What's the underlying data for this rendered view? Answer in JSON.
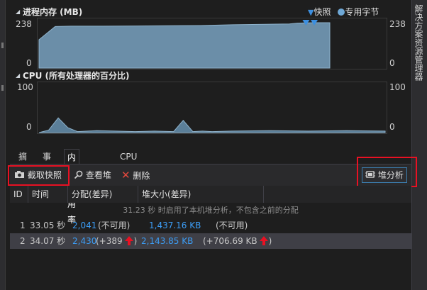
{
  "right_panel": {
    "label": "解决方案资源管理器"
  },
  "memory_panel": {
    "title": "进程内存 (MB)",
    "legend_snapshot": "快照",
    "legend_private": "专用字节",
    "y_max": "238",
    "y_min": "0",
    "y_max_right": "238",
    "y_min_right": "0",
    "colors": {
      "fill": "#6b8ea8",
      "stroke": "#8fb3cc",
      "snapshot_marker": "#3c8fe0"
    }
  },
  "cpu_panel": {
    "title": "CPU (所有处理器的百分比)",
    "y_max": "100",
    "y_min": "0",
    "y_max_right": "100",
    "y_min_right": "0"
  },
  "tabs": [
    {
      "label": "摘要"
    },
    {
      "label": "事件"
    },
    {
      "label": "内存使用率",
      "active": true
    },
    {
      "label": "CPU 使用率"
    }
  ],
  "toolbar": {
    "take_snapshot": "截取快照",
    "view_heap": "查看堆",
    "delete": "删除",
    "heap_profiling": "堆分析"
  },
  "table": {
    "headers": [
      "ID",
      "时间",
      "分配(差异)",
      "堆大小(差异)"
    ],
    "notice": "31.23 秒 时启用了本机堆分析，不包含之前的分配",
    "rows": [
      {
        "id": "1",
        "time": "33.05 秒",
        "alloc": "2,041",
        "alloc_diff": "(不可用)",
        "heap": "1,437.16 KB",
        "heap_diff": "(不可用)"
      },
      {
        "id": "2",
        "time": "34.07 秒",
        "alloc": "2,430",
        "alloc_diff": "(+389",
        "heap": "2,143.85 KB",
        "heap_diff": "(+706.69 KB",
        "alloc_paren_close": ")",
        "heap_paren_close": ")"
      }
    ]
  },
  "chart_data": [
    {
      "type": "area",
      "title": "进程内存 (MB)",
      "ylim": [
        0,
        238
      ],
      "series": [
        {
          "name": "专用字节",
          "x": [
            0,
            2,
            4,
            8,
            12,
            16,
            20,
            24,
            28,
            31,
            32,
            34,
            36
          ],
          "values": [
            140,
            205,
            207,
            207,
            208,
            209,
            210,
            214,
            216,
            218,
            222,
            224,
            224
          ]
        }
      ],
      "snapshots_at": [
        33.05,
        34.07
      ],
      "legend": "top-right"
    },
    {
      "type": "area",
      "title": "CPU (所有处理器的百分比)",
      "ylim": [
        0,
        100
      ],
      "series": [
        {
          "x": [
            0,
            1,
            2,
            3,
            4,
            6,
            8,
            10,
            12,
            14,
            15,
            16,
            17,
            18,
            20,
            24,
            28,
            32,
            36
          ],
          "values": [
            0,
            5,
            30,
            10,
            2,
            4,
            3,
            2,
            3,
            2,
            25,
            2,
            3,
            2,
            3,
            4,
            3,
            4,
            3
          ]
        }
      ]
    }
  ]
}
